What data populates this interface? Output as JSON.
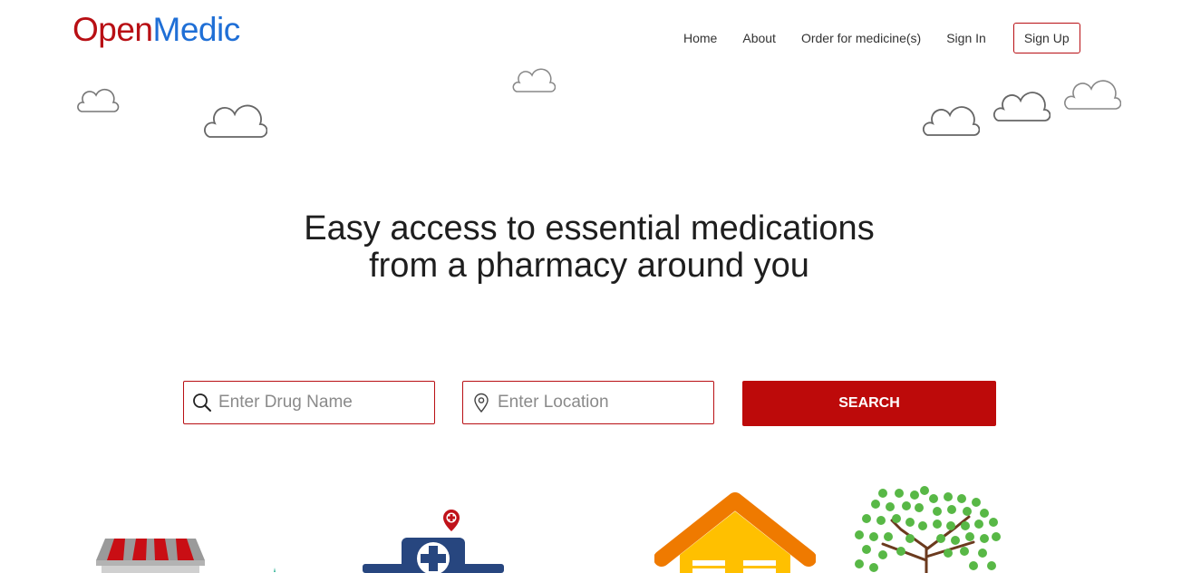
{
  "brand": {
    "part1": "Open",
    "part2": "Medic"
  },
  "nav": {
    "items": [
      "Home",
      "About",
      "Order for medicine(s)",
      "Sign In"
    ],
    "signup_label": "Sign Up"
  },
  "hero": {
    "line1": "Easy access to essential medications",
    "line2": "from a pharmacy around you"
  },
  "search": {
    "drug_placeholder": "Enter Drug Name",
    "location_placeholder": "Enter Location",
    "button_label": "SEARCH"
  },
  "colors": {
    "brand_red": "#b80f14",
    "brand_blue": "#1f6fd6",
    "button": "#bd0a0a"
  },
  "icons": [
    "search-icon",
    "location-pin-icon"
  ]
}
